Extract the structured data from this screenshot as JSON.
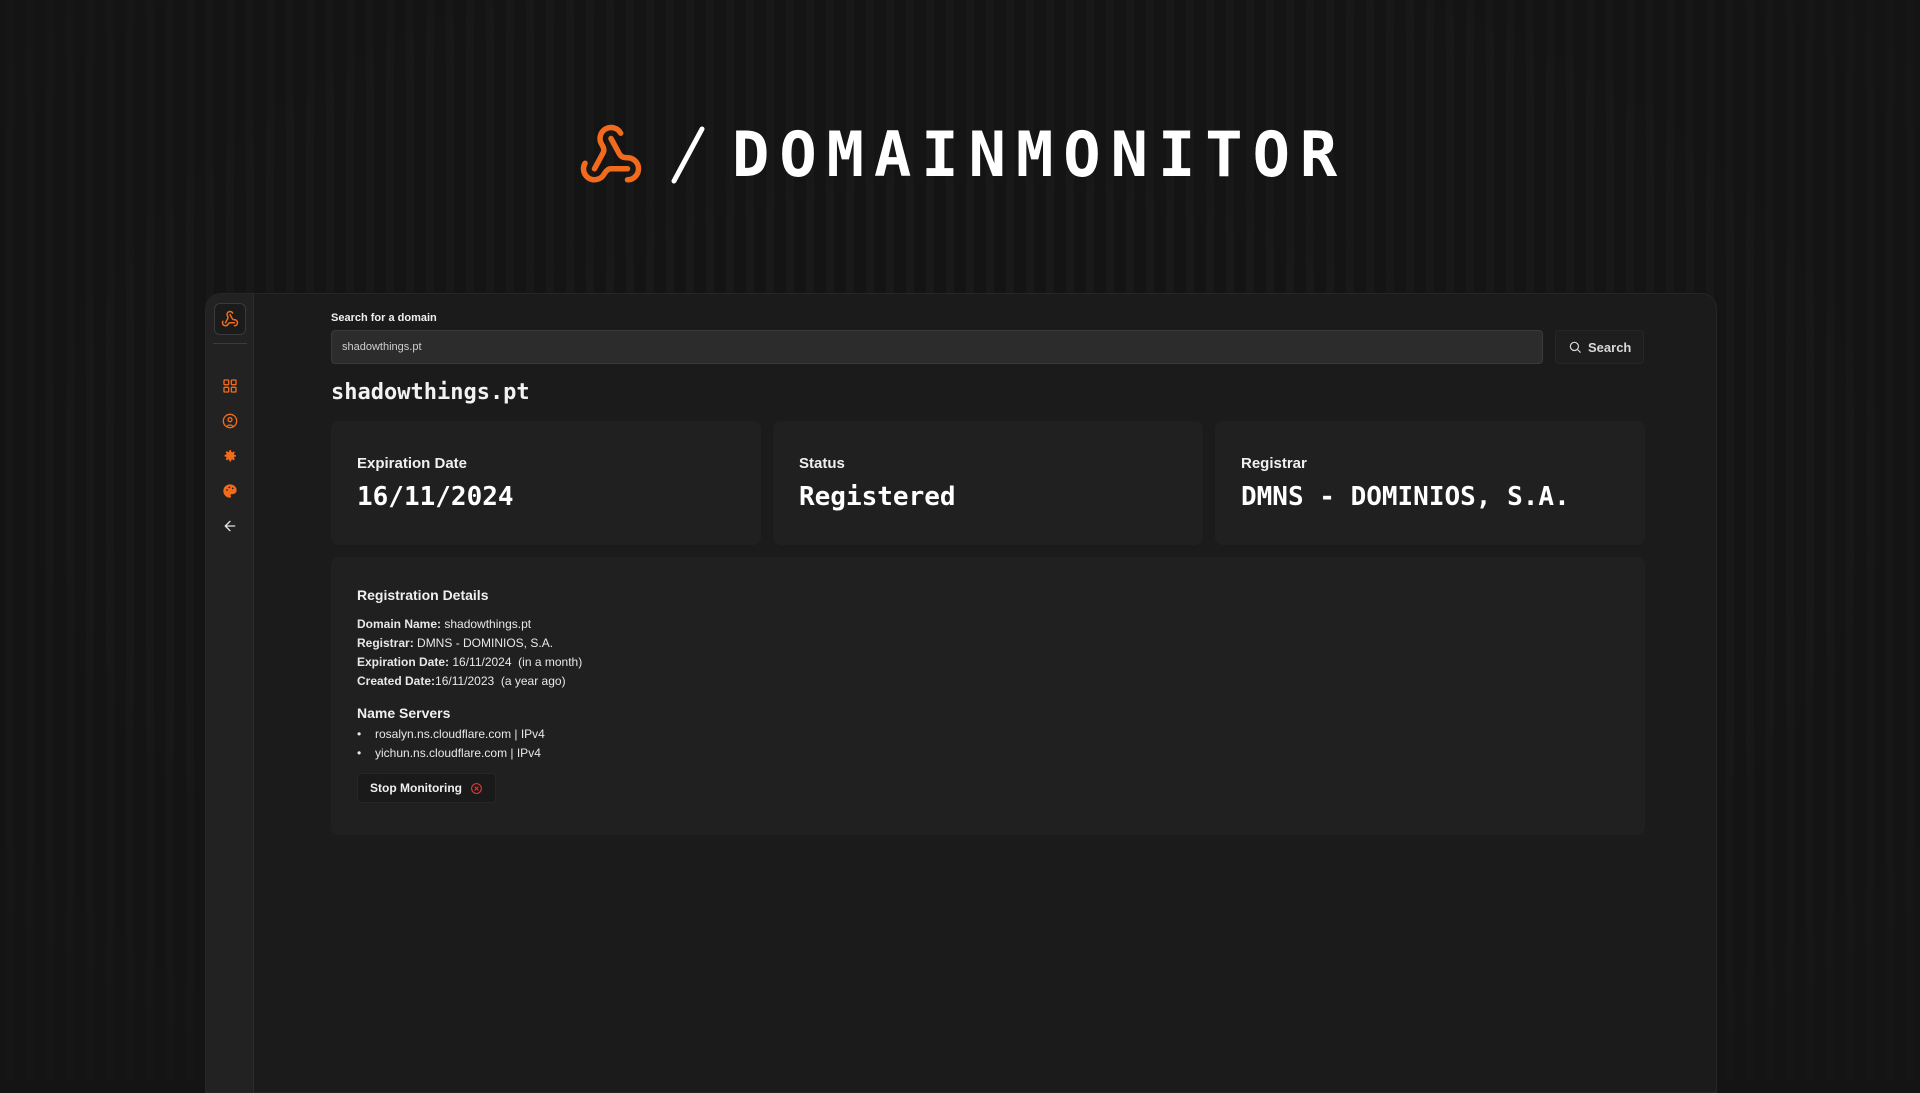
{
  "brand": {
    "wordmark": "DOMAINMONITOR",
    "accent": "#f26b1d"
  },
  "sidebar": {
    "items": [
      {
        "icon": "dashboard-grid-icon"
      },
      {
        "icon": "user-circle-icon"
      },
      {
        "icon": "gear-icon"
      },
      {
        "icon": "palette-icon"
      },
      {
        "icon": "arrow-left-icon"
      }
    ]
  },
  "search": {
    "label": "Search for a domain",
    "value": "shadowthings.pt",
    "button_label": "Search"
  },
  "domain": {
    "title": "shadowthings.pt"
  },
  "cards": [
    {
      "label": "Expiration Date",
      "value": "16/11/2024"
    },
    {
      "label": "Status",
      "value": "Registered"
    },
    {
      "label": "Registrar",
      "value": "DMNS - DOMINIOS, S.A."
    }
  ],
  "details": {
    "title": "Registration Details",
    "domain_name_label": "Domain Name:",
    "domain_name_value": " shadowthings.pt",
    "registrar_label": "Registrar:",
    "registrar_value": " DMNS - DOMINIOS, S.A.",
    "expiration_label": "Expiration Date:",
    "expiration_value": " 16/11/2024  (in a month)",
    "created_label": "Created Date:",
    "created_value": "16/11/2023  (a year ago)",
    "name_servers_title": "Name Servers",
    "name_servers": [
      "rosalyn.ns.cloudflare.com | IPv4",
      "yichun.ns.cloudflare.com | IPv4"
    ],
    "stop_button_label": "Stop Monitoring"
  },
  "colors": {
    "background": "#141414",
    "panel": "#202020",
    "sidebar": "#222222",
    "accent": "#f26b1d",
    "danger": "#e03b3b"
  }
}
